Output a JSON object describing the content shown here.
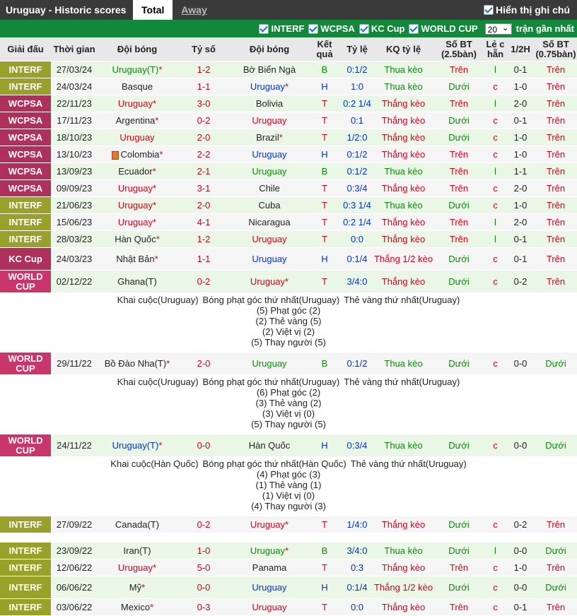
{
  "header": {
    "title": "Uruguay - Historic scores",
    "tab_total": "Total",
    "tab_away": "Away",
    "owner_label": "Hiển thị ghi chú"
  },
  "filters": {
    "items": [
      "INTERF",
      "WCPSA",
      "KC Cup",
      "WORLD CUP"
    ],
    "count_value": "20",
    "count_suffix": "trận gần nhất"
  },
  "columns": [
    "Giải đấu",
    "Thời gian",
    "Đội bóng",
    "Tỷ số",
    "Đội bóng",
    "Kết quả",
    "Tỷ lệ",
    "KQ tỷ lệ",
    "Số BT (2.5bàn)",
    "Lẻ c hẵn",
    "1/2H",
    "Số BT (0.75bàn)"
  ],
  "colors": {
    "INTERF": "#9aa12a",
    "WCPSA": "#b0305c",
    "KC Cup": "#b0305c",
    "WORLD CUP": "#c8366a",
    "win": "#d0021b",
    "draw": "#0b8a0b",
    "loss": "#0033cc"
  },
  "matches": [
    {
      "league": "INTERF",
      "date": "27/03/24",
      "home": "Uruguay(T)",
      "home_star": "*",
      "home_color": "green",
      "score": "1-2",
      "away": "Bờ Biển Ngà",
      "away_star": "",
      "away_color": "",
      "res": "B",
      "res_color": "green",
      "hcp": "0:1/2",
      "hcp_res": "Thua kèo",
      "hcp_color": "green",
      "ou": "Trên",
      "ou_color": "red",
      "oe": "l",
      "oe_color": "green",
      "ht": "0-1",
      "ou2": "Trên",
      "ou2_color": "red"
    },
    {
      "league": "INTERF",
      "date": "24/03/24",
      "home": "Basque",
      "home_star": "",
      "home_color": "",
      "score": "1-1",
      "away": "Uruguay",
      "away_star": "*",
      "away_color": "blue",
      "res": "H",
      "res_color": "blue",
      "hcp": "1:0",
      "hcp_res": "Thua kèo",
      "hcp_color": "green",
      "ou": "Dưới",
      "ou_color": "green",
      "oe": "c",
      "oe_color": "red",
      "ht": "1-0",
      "ou2": "Trên",
      "ou2_color": "red"
    },
    {
      "league": "WCPSA",
      "date": "22/11/23",
      "home": "Uruguay",
      "home_star": "*",
      "home_color": "red",
      "score": "3-0",
      "away": "Bolivia",
      "away_star": "",
      "away_color": "",
      "res": "T",
      "res_color": "red",
      "hcp": "0:2 1/4",
      "hcp_res": "Thắng kèo",
      "hcp_color": "red",
      "ou": "Trên",
      "ou_color": "red",
      "oe": "l",
      "oe_color": "green",
      "ht": "2-0",
      "ou2": "Trên",
      "ou2_color": "red"
    },
    {
      "league": "WCPSA",
      "date": "17/11/23",
      "home": "Argentina",
      "home_star": "*",
      "home_color": "",
      "score": "0-2",
      "away": "Uruguay",
      "away_star": "",
      "away_color": "red",
      "res": "T",
      "res_color": "red",
      "hcp": "0:1",
      "hcp_res": "Thắng kèo",
      "hcp_color": "red",
      "ou": "Dưới",
      "ou_color": "green",
      "oe": "c",
      "oe_color": "red",
      "ht": "0-1",
      "ou2": "Trên",
      "ou2_color": "red"
    },
    {
      "league": "WCPSA",
      "date": "18/10/23",
      "home": "Uruguay",
      "home_star": "",
      "home_color": "red",
      "score": "2-0",
      "away": "Brazil",
      "away_star": "*",
      "away_color": "",
      "res": "T",
      "res_color": "red",
      "hcp": "1/2:0",
      "hcp_res": "Thắng kèo",
      "hcp_color": "red",
      "ou": "Dưới",
      "ou_color": "green",
      "oe": "c",
      "oe_color": "red",
      "ht": "1-0",
      "ou2": "Trên",
      "ou2_color": "red"
    },
    {
      "league": "WCPSA",
      "date": "13/10/23",
      "home": "Colombia",
      "home_star": "*",
      "home_color": "",
      "home_flag": true,
      "score": "2-2",
      "away": "Uruguay",
      "away_star": "",
      "away_color": "blue",
      "res": "H",
      "res_color": "blue",
      "hcp": "0:1/2",
      "hcp_res": "Thắng kèo",
      "hcp_color": "red",
      "ou": "Trên",
      "ou_color": "red",
      "oe": "c",
      "oe_color": "red",
      "ht": "1-0",
      "ou2": "Trên",
      "ou2_color": "red"
    },
    {
      "league": "WCPSA",
      "date": "13/09/23",
      "home": "Ecuador",
      "home_star": "*",
      "home_color": "",
      "score": "2-1",
      "away": "Uruguay",
      "away_star": "",
      "away_color": "green",
      "res": "B",
      "res_color": "green",
      "hcp": "0:1/2",
      "hcp_res": "Thua kèo",
      "hcp_color": "green",
      "ou": "Trên",
      "ou_color": "red",
      "oe": "l",
      "oe_color": "green",
      "ht": "1-1",
      "ou2": "Trên",
      "ou2_color": "red"
    },
    {
      "league": "WCPSA",
      "date": "09/09/23",
      "home": "Uruguay",
      "home_star": "*",
      "home_color": "red",
      "score": "3-1",
      "away": "Chile",
      "away_star": "",
      "away_color": "",
      "res": "T",
      "res_color": "red",
      "hcp": "0:3/4",
      "hcp_res": "Thắng kèo",
      "hcp_color": "red",
      "ou": "Trên",
      "ou_color": "red",
      "oe": "c",
      "oe_color": "red",
      "ht": "2-0",
      "ou2": "Trên",
      "ou2_color": "red"
    },
    {
      "league": "INTERF",
      "date": "21/06/23",
      "home": "Uruguay",
      "home_star": "*",
      "home_color": "red",
      "score": "2-0",
      "away": "Cuba",
      "away_star": "",
      "away_color": "",
      "res": "T",
      "res_color": "red",
      "hcp": "0:3 1/4",
      "hcp_res": "Thua kèo",
      "hcp_color": "green",
      "ou": "Dưới",
      "ou_color": "green",
      "oe": "c",
      "oe_color": "red",
      "ht": "1-0",
      "ou2": "Trên",
      "ou2_color": "red"
    },
    {
      "league": "INTERF",
      "date": "15/06/23",
      "home": "Uruguay",
      "home_star": "*",
      "home_color": "red",
      "score": "4-1",
      "away": "Nicaragua",
      "away_star": "",
      "away_color": "",
      "res": "T",
      "res_color": "red",
      "hcp": "0:2 1/4",
      "hcp_res": "Thắng kèo",
      "hcp_color": "red",
      "ou": "Trên",
      "ou_color": "red",
      "oe": "l",
      "oe_color": "green",
      "ht": "2-0",
      "ou2": "Trên",
      "ou2_color": "red"
    },
    {
      "league": "INTERF",
      "date": "28/03/23",
      "home": "Hàn Quốc",
      "home_star": "*",
      "home_color": "",
      "score": "1-2",
      "away": "Uruguay",
      "away_star": "",
      "away_color": "red",
      "res": "T",
      "res_color": "red",
      "hcp": "0:0",
      "hcp_res": "Thắng kèo",
      "hcp_color": "red",
      "ou": "Trên",
      "ou_color": "red",
      "oe": "l",
      "oe_color": "green",
      "ht": "0-1",
      "ou2": "Trên",
      "ou2_color": "red"
    },
    {
      "league": "KC Cup",
      "date": "24/03/23",
      "home": "Nhật Bản",
      "home_star": "*",
      "home_color": "",
      "score": "1-1",
      "away": "Uruguay",
      "away_star": "",
      "away_color": "blue",
      "res": "H",
      "res_color": "blue",
      "hcp": "0:1/4",
      "hcp_res": "Thắng 1/2 kèo",
      "hcp_color": "red",
      "ou": "Dưới",
      "ou_color": "green",
      "oe": "c",
      "oe_color": "red",
      "ht": "0-1",
      "ou2": "Trên",
      "ou2_color": "red"
    },
    {
      "league": "WORLD CUP",
      "date": "02/12/22",
      "home": "Ghana(T)",
      "home_star": "",
      "home_color": "",
      "score": "0-2",
      "away": "Uruguay",
      "away_star": "*",
      "away_color": "red",
      "res": "T",
      "res_color": "red",
      "hcp": "3/4:0",
      "hcp_res": "Thắng kèo",
      "hcp_color": "red",
      "ou": "Dưới",
      "ou_color": "green",
      "oe": "c",
      "oe_color": "red",
      "ht": "0-2",
      "ou2": "Trên",
      "ou2_color": "red",
      "detail": {
        "top": [
          "Khai cuộc(Uruguay)",
          "Bóng phạt góc thứ nhất(Uruguay)",
          "Thẻ vàng thứ nhất(Uruguay)"
        ],
        "lines": [
          "(5) Phạt góc (2)",
          "(2) Thẻ vàng (5)",
          "(2) Việt vị (2)",
          "(5) Thay người (5)"
        ]
      }
    },
    {
      "league": "WORLD CUP",
      "date": "29/11/22",
      "home": "Bồ Đào Nha(T)",
      "home_star": "*",
      "home_color": "",
      "score": "2-0",
      "away": "Uruguay",
      "away_star": "",
      "away_color": "green",
      "res": "B",
      "res_color": "green",
      "hcp": "0:1/2",
      "hcp_res": "Thua kèo",
      "hcp_color": "green",
      "ou": "Dưới",
      "ou_color": "green",
      "oe": "c",
      "oe_color": "red",
      "ht": "0-0",
      "ou2": "Dưới",
      "ou2_color": "green",
      "detail": {
        "top": [
          "Khai cuộc(Uruguay)",
          "Bóng phạt góc thứ nhất(Uruguay)",
          "Thẻ vàng thứ nhất(Uruguay)"
        ],
        "lines": [
          "(6) Phạt góc (2)",
          "(3) Thẻ vàng (2)",
          "(3) Việt vị (0)",
          "(5) Thay người (5)"
        ]
      }
    },
    {
      "league": "WORLD CUP",
      "date": "24/11/22",
      "home": "Uruguay(T)",
      "home_star": "*",
      "home_color": "blue",
      "score": "0-0",
      "away": "Hàn Quốc",
      "away_star": "",
      "away_color": "",
      "res": "H",
      "res_color": "blue",
      "hcp": "0:3/4",
      "hcp_res": "Thua kèo",
      "hcp_color": "green",
      "ou": "Dưới",
      "ou_color": "green",
      "oe": "c",
      "oe_color": "red",
      "ht": "0-0",
      "ou2": "Dưới",
      "ou2_color": "green",
      "detail": {
        "top": [
          "Khai cuộc(Hàn Quốc)",
          "Bóng phạt góc thứ nhất(Hàn Quốc)",
          "Thẻ vàng thứ nhất(Uruguay)"
        ],
        "lines": [
          "(4) Phạt góc (3)",
          "(1) Thẻ vàng (1)",
          "(1) Việt vị (0)",
          "(4) Thay người (3)"
        ]
      }
    },
    {
      "league": "INTERF",
      "date": "27/09/22",
      "home": "Canada(T)",
      "home_star": "",
      "home_color": "",
      "score": "0-2",
      "away": "Uruguay",
      "away_star": "*",
      "away_color": "red",
      "res": "T",
      "res_color": "red",
      "hcp": "1/4:0",
      "hcp_res": "Thắng kèo",
      "hcp_color": "red",
      "ou": "Dưới",
      "ou_color": "green",
      "oe": "c",
      "oe_color": "red",
      "ht": "0-2",
      "ou2": "Trên",
      "ou2_color": "red",
      "spacer_after": true
    },
    {
      "league": "INTERF",
      "date": "23/09/22",
      "home": "Iran(T)",
      "home_star": "",
      "home_color": "",
      "score": "1-0",
      "away": "Uruguay",
      "away_star": "*",
      "away_color": "green",
      "res": "B",
      "res_color": "green",
      "hcp": "3/4:0",
      "hcp_res": "Thua kèo",
      "hcp_color": "green",
      "ou": "Dưới",
      "ou_color": "green",
      "oe": "l",
      "oe_color": "green",
      "ht": "0-0",
      "ou2": "Dưới",
      "ou2_color": "green"
    },
    {
      "league": "INTERF",
      "date": "12/06/22",
      "home": "Uruguay",
      "home_star": "*",
      "home_color": "red",
      "score": "5-0",
      "away": "Panama",
      "away_star": "",
      "away_color": "",
      "res": "T",
      "res_color": "red",
      "hcp": "0:3",
      "hcp_res": "Thắng kèo",
      "hcp_color": "red",
      "ou": "Trên",
      "ou_color": "red",
      "oe": "c",
      "oe_color": "red",
      "ht": "1-0",
      "ou2": "Trên",
      "ou2_color": "red"
    },
    {
      "league": "INTERF",
      "date": "06/06/22",
      "home": "Mỹ",
      "home_star": "*",
      "home_color": "",
      "score": "0-0",
      "away": "Uruguay",
      "away_star": "",
      "away_color": "blue",
      "res": "H",
      "res_color": "blue",
      "hcp": "0:1/4",
      "hcp_res": "Thắng 1/2 kèo",
      "hcp_color": "red",
      "ou": "Dưới",
      "ou_color": "green",
      "oe": "c",
      "oe_color": "red",
      "ht": "0-0",
      "ou2": "Dưới",
      "ou2_color": "green"
    },
    {
      "league": "INTERF",
      "date": "03/06/22",
      "home": "Mexico",
      "home_star": "*",
      "home_color": "",
      "score": "0-3",
      "away": "Uruguay",
      "away_star": "",
      "away_color": "red",
      "res": "T",
      "res_color": "red",
      "hcp": "0:0",
      "hcp_res": "Thắng kèo",
      "hcp_color": "red",
      "ou": "Trên",
      "ou_color": "red",
      "oe": "c",
      "oe_color": "red",
      "ht": "0-1",
      "ou2": "Trên",
      "ou2_color": "red"
    }
  ]
}
